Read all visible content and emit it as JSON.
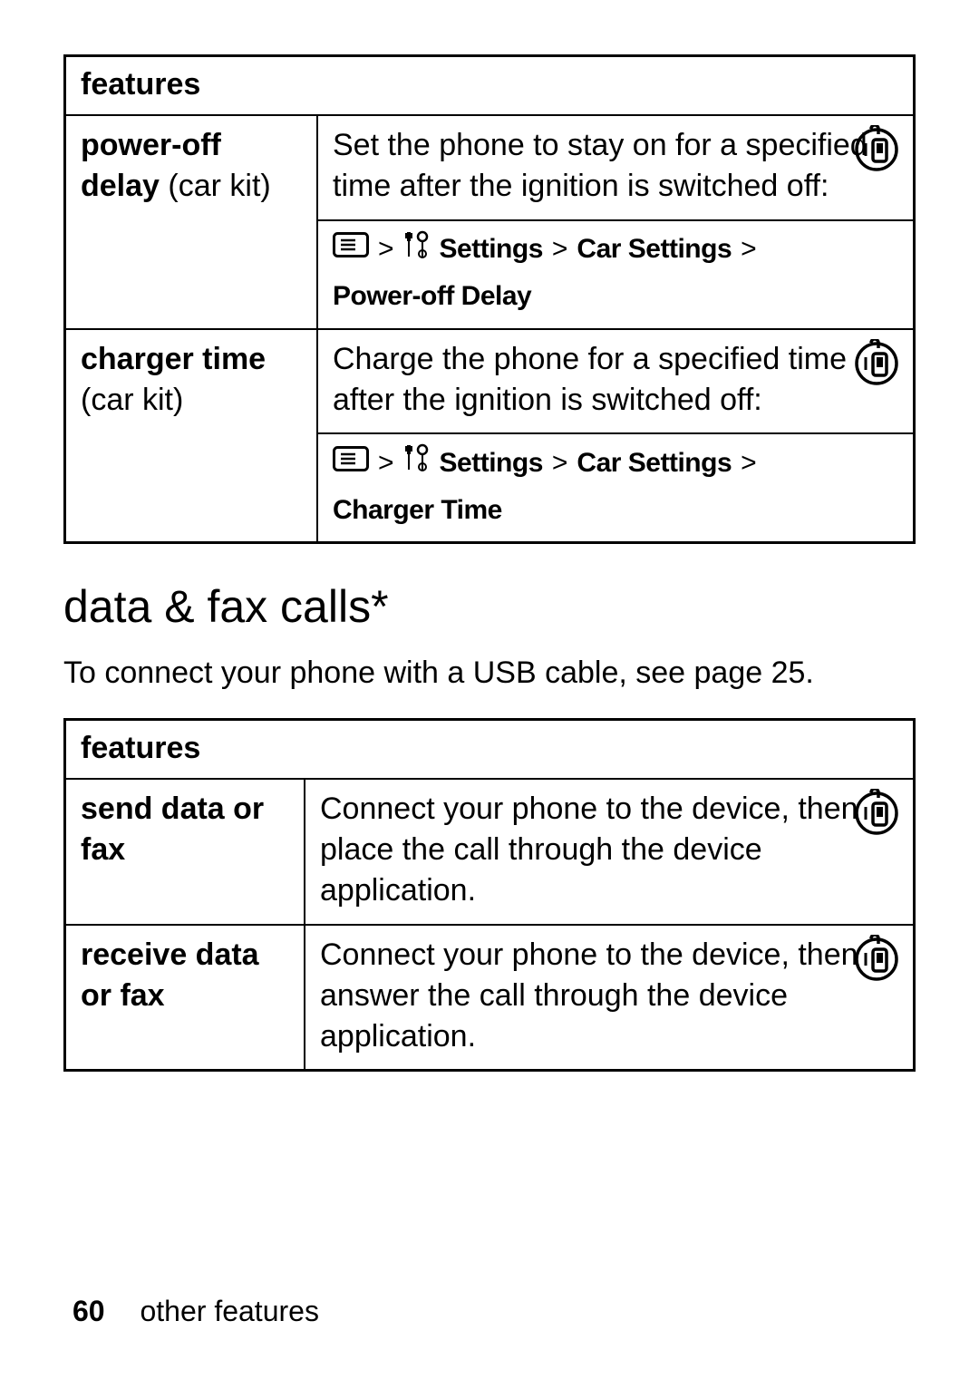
{
  "table1": {
    "header": "features",
    "rows": [
      {
        "label_bold": "power-off delay",
        "label_rest": " (car kit)",
        "desc": "Set the phone to stay on for a specified time after the ignition is switched off:",
        "path_segments": [
          "Settings",
          "Car Settings",
          "Power-off Delay"
        ]
      },
      {
        "label_bold": "charger time",
        "label_rest": "(car kit)",
        "label_break": true,
        "desc": "Charge the phone for a specified time after the ignition is switched off:",
        "path_segments": [
          "Settings",
          "Car Settings",
          "Charger Time"
        ]
      }
    ]
  },
  "section_title": "data & fax calls*",
  "intro_text": "To connect your phone with a USB cable, see page 25.",
  "table2": {
    "header": "features",
    "rows": [
      {
        "label_bold": "send data or fax",
        "desc": "Connect your phone to the device, then place the call through the device application."
      },
      {
        "label_bold": "receive data or fax",
        "desc": "Connect your phone to the device, then answer the call through the device application."
      }
    ]
  },
  "footer": {
    "page_number": "60",
    "section": "other features"
  }
}
